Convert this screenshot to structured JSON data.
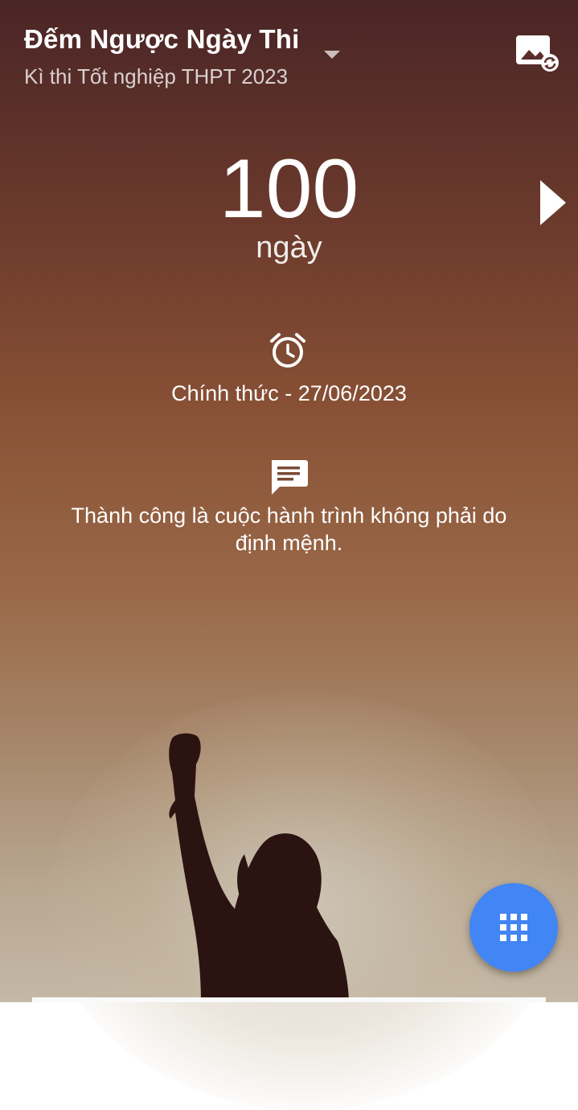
{
  "header": {
    "title": "Đếm Ngược Ngày Thi",
    "subtitle": "Kì thi Tốt nghiệp THPT 2023",
    "dropdown_icon": "caret-down-icon",
    "change_background_icon": "image-refresh-icon"
  },
  "countdown": {
    "value": "100",
    "unit": "ngày",
    "next_icon": "chevron-right-icon"
  },
  "exam_date": {
    "icon": "alarm-clock-icon",
    "text": "Chính thức - 27/06/2023"
  },
  "quote": {
    "icon": "message-icon",
    "text": "Thành công là cuộc hành trình không phải do định mệnh."
  },
  "fab": {
    "icon": "apps-grid-icon",
    "color": "#4285f4"
  }
}
